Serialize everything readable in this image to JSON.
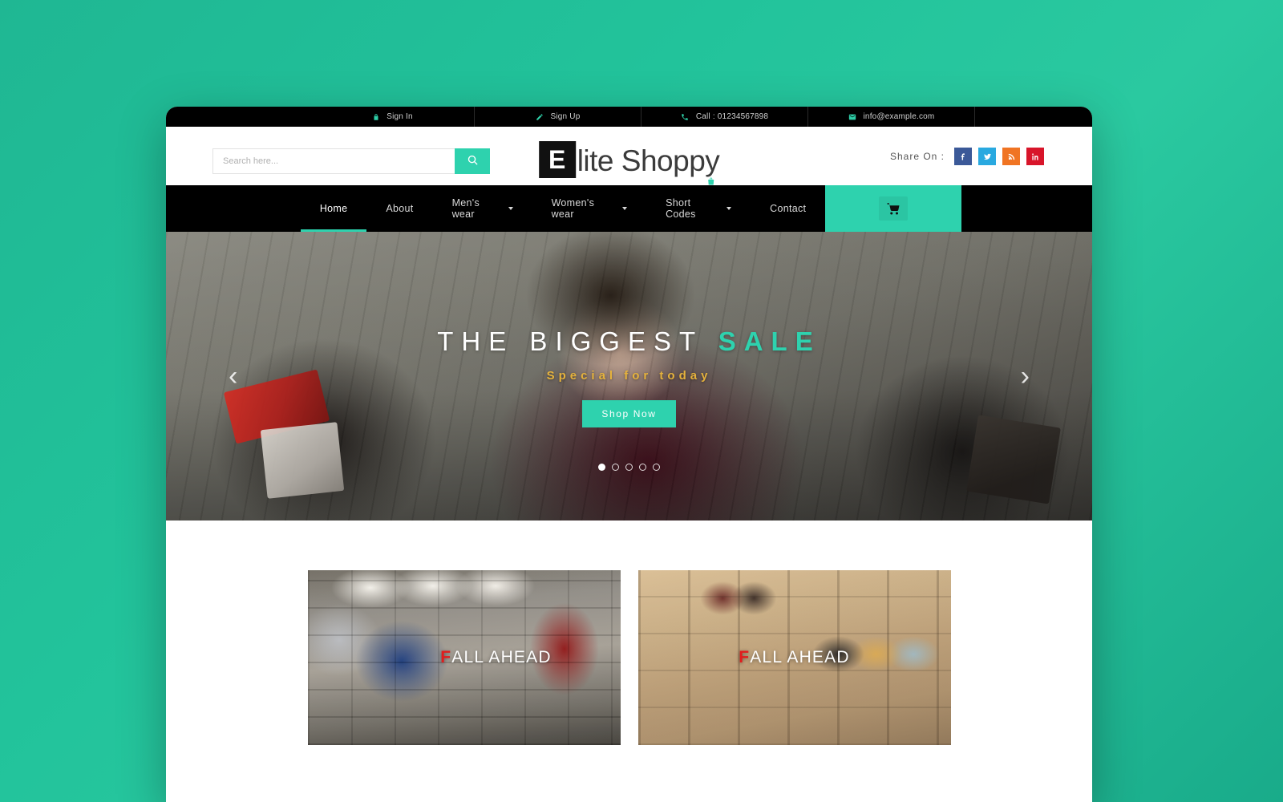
{
  "theme": {
    "accent": "#2ed2ae",
    "desktop_bg": "#22c39b",
    "nav_bg": "#000000",
    "promo_highlight": "#e11d1d",
    "hero_sub_color": "#e5b23c"
  },
  "topbar": {
    "items": [
      {
        "icon": "lock-icon",
        "label": "Sign In"
      },
      {
        "icon": "edit-icon",
        "label": "Sign Up"
      },
      {
        "icon": "phone-icon",
        "label": "Call : 01234567898"
      },
      {
        "icon": "envelope-icon",
        "label": "info@example.com"
      }
    ]
  },
  "header": {
    "search": {
      "placeholder": "Search here...",
      "value": "",
      "button_icon": "search-icon"
    },
    "logo": {
      "badge": "E",
      "text": "lite Shoppy",
      "bag_icon": "shopping-bag-icon"
    },
    "share": {
      "label": "Share On :",
      "socials": [
        {
          "name": "facebook",
          "glyph": "f",
          "color": "#3b5998"
        },
        {
          "name": "twitter",
          "glyph": "t",
          "color": "#29a9e0"
        },
        {
          "name": "rss",
          "glyph": "r",
          "color": "#f07423"
        },
        {
          "name": "linkedin",
          "glyph": "in",
          "color": "#d8152a"
        }
      ]
    }
  },
  "nav": {
    "items": [
      {
        "label": "Home",
        "has_dropdown": false,
        "active": true
      },
      {
        "label": "About",
        "has_dropdown": false,
        "active": false
      },
      {
        "label": "Men's wear",
        "has_dropdown": true,
        "active": false
      },
      {
        "label": "Women's wear",
        "has_dropdown": true,
        "active": false
      },
      {
        "label": "Short Codes",
        "has_dropdown": true,
        "active": false
      },
      {
        "label": "Contact",
        "has_dropdown": false,
        "active": false
      }
    ],
    "cart": {
      "icon": "cart-icon",
      "label": ""
    }
  },
  "hero": {
    "title_main": "THE BIGGEST ",
    "title_accent": "SALE",
    "subtitle": "Special for today",
    "cta": "Shop Now",
    "prev_arrow": "‹",
    "next_arrow": "›",
    "slide_count": 5,
    "active_slide": 1
  },
  "promos": [
    {
      "label_f": "F",
      "label_rest": "ALL AHEAD",
      "alt": "clothing store interior"
    },
    {
      "label_f": "F",
      "label_rest": "ALL AHEAD",
      "alt": "handbag store display"
    }
  ]
}
